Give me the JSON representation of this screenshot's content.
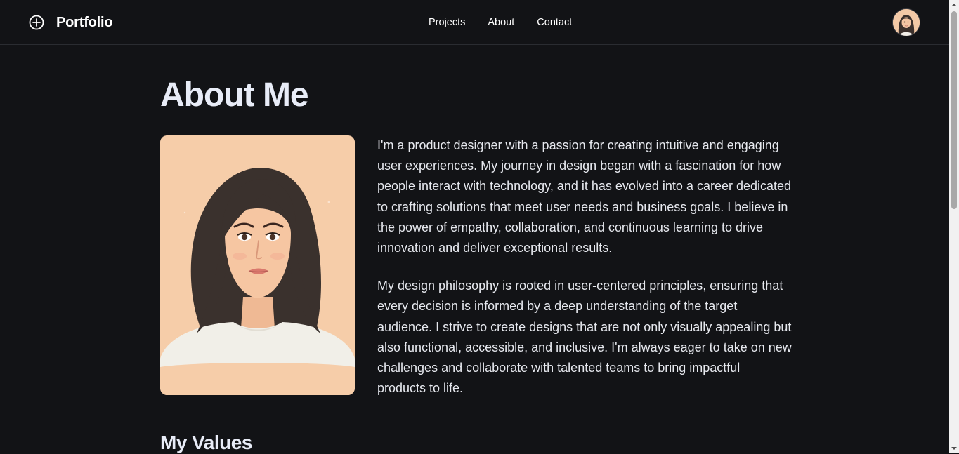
{
  "header": {
    "brand_name": "Portfolio",
    "brand_icon": "plus-circle-icon",
    "nav": [
      {
        "label": "Projects"
      },
      {
        "label": "About"
      },
      {
        "label": "Contact"
      }
    ]
  },
  "main": {
    "title": "About Me",
    "bio": [
      "I'm a product designer with a passion for creating intuitive and engaging user experiences. My journey in design began with a fascination for how people interact with technology, and it has evolved into a career dedicated to crafting solutions that meet user needs and business goals. I believe in the power of empathy, collaboration, and continuous learning to drive innovation and deliver exceptional results.",
      "My design philosophy is rooted in user-centered principles, ensuring that every decision is informed by a deep understanding of the target audience. I strive to create designs that are not only visually appealing but also functional, accessible, and inclusive. I'm always eager to take on new challenges and collaborate with talented teams to bring impactful products to life."
    ],
    "values_title": "My Values"
  },
  "colors": {
    "background": "#121316",
    "portrait_bg": "#f6cda9",
    "text": "#e6e8ee"
  }
}
